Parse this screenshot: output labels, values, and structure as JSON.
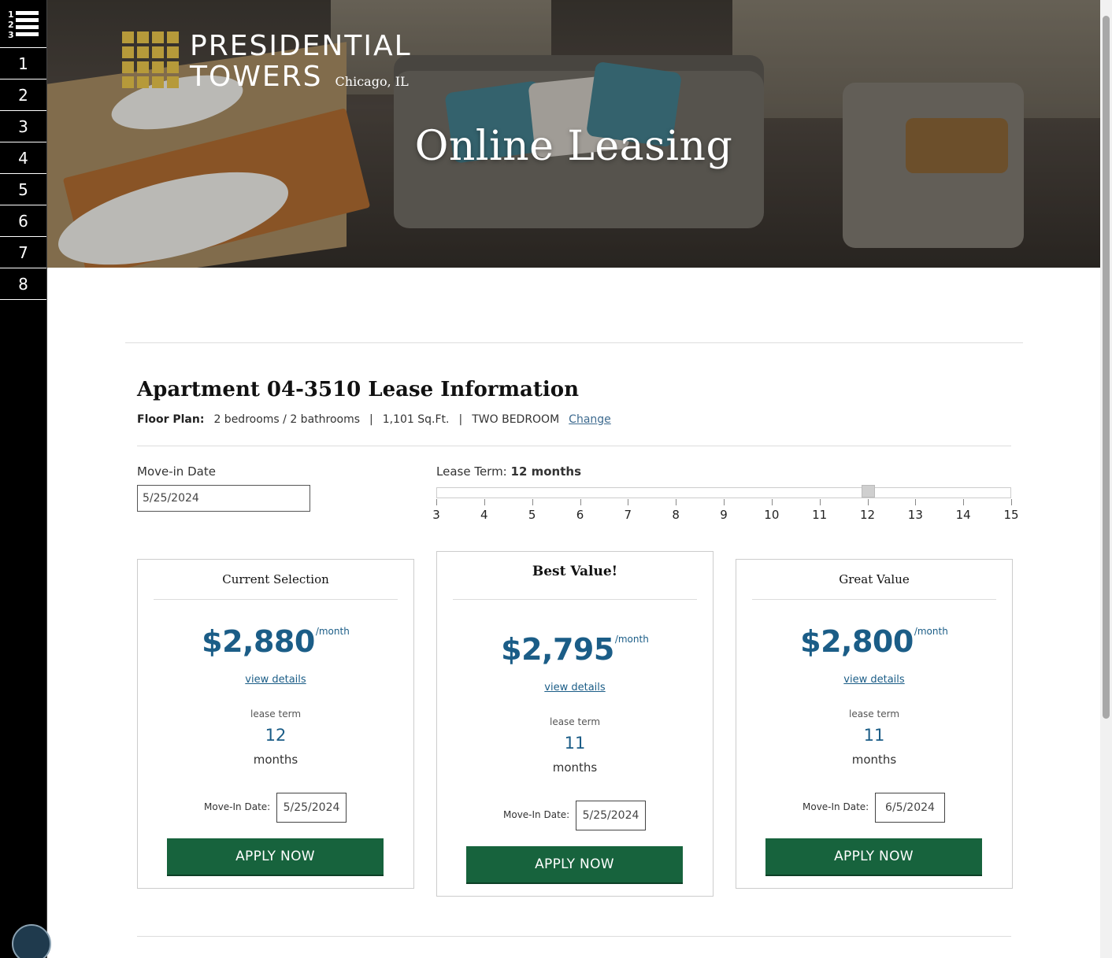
{
  "brand": {
    "name_line1": "PRESIDENTIAL",
    "name_line2": "TOWERS",
    "city": "Chicago, IL",
    "logo_color": "#b69a3a"
  },
  "hero": {
    "title": "Online Leasing"
  },
  "step_nav": {
    "menu_icon": "numbered-list-icon",
    "steps": [
      "1",
      "2",
      "3",
      "4",
      "5",
      "6",
      "7",
      "8"
    ]
  },
  "apartment": {
    "number": "Apartment 04-3510",
    "title_suffix": " Lease Information",
    "floor_plan_label": "Floor Plan:",
    "bedrooms": "2 bedrooms / 2 bathrooms",
    "sqft": "1,101 Sq.Ft.",
    "plan_name": "TWO BEDROOM",
    "change_link": "Change",
    "separator": "|"
  },
  "move_in": {
    "label": "Move-in Date",
    "value": "5/25/2024"
  },
  "lease_term": {
    "label": "Lease Term: ",
    "value": "12 months",
    "selected": 12,
    "ticks": [
      "3",
      "4",
      "5",
      "6",
      "7",
      "8",
      "9",
      "10",
      "11",
      "12",
      "13",
      "14",
      "15"
    ]
  },
  "cards": [
    {
      "heading": "Current Selection",
      "price": "$2,880",
      "per": "/month",
      "details": "view details",
      "term_label": "lease term",
      "term": "12",
      "term_unit": "months",
      "move_in_label": "Move-In Date:",
      "move_in": "5/25/2024",
      "apply": "APPLY NOW"
    },
    {
      "heading": "Best Value!",
      "price": "$2,795",
      "per": "/month",
      "details": "view details",
      "term_label": "lease term",
      "term": "11",
      "term_unit": "months",
      "move_in_label": "Move-In Date:",
      "move_in": "5/25/2024",
      "apply": "APPLY NOW"
    },
    {
      "heading": "Great Value",
      "price": "$2,800",
      "per": "/month",
      "details": "view details",
      "term_label": "lease term",
      "term": "11",
      "term_unit": "months",
      "move_in_label": "Move-In Date:",
      "move_in": "6/5/2024",
      "apply": "APPLY NOW"
    }
  ],
  "colors": {
    "accent_blue": "#1b5d87",
    "apply_green": "#17633d"
  },
  "chat": {
    "icon": "chat-bubble-icon"
  }
}
